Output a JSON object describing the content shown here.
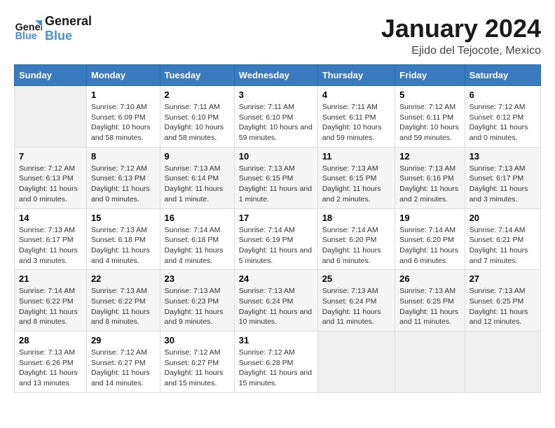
{
  "logo": {
    "line1": "General",
    "line2": "Blue"
  },
  "title": "January 2024",
  "subtitle": "Ejido del Tejocote, Mexico",
  "days_header": [
    "Sunday",
    "Monday",
    "Tuesday",
    "Wednesday",
    "Thursday",
    "Friday",
    "Saturday"
  ],
  "weeks": [
    [
      {
        "day": "",
        "empty": true
      },
      {
        "day": "1",
        "sunrise": "7:10 AM",
        "sunset": "6:09 PM",
        "daylight": "10 hours and 58 minutes."
      },
      {
        "day": "2",
        "sunrise": "7:11 AM",
        "sunset": "6:10 PM",
        "daylight": "10 hours and 58 minutes."
      },
      {
        "day": "3",
        "sunrise": "7:11 AM",
        "sunset": "6:10 PM",
        "daylight": "10 hours and 59 minutes."
      },
      {
        "day": "4",
        "sunrise": "7:11 AM",
        "sunset": "6:11 PM",
        "daylight": "10 hours and 59 minutes."
      },
      {
        "day": "5",
        "sunrise": "7:12 AM",
        "sunset": "6:11 PM",
        "daylight": "10 hours and 59 minutes."
      },
      {
        "day": "6",
        "sunrise": "7:12 AM",
        "sunset": "6:12 PM",
        "daylight": "11 hours and 0 minutes."
      }
    ],
    [
      {
        "day": "7",
        "sunrise": "7:12 AM",
        "sunset": "6:13 PM",
        "daylight": "11 hours and 0 minutes."
      },
      {
        "day": "8",
        "sunrise": "7:12 AM",
        "sunset": "6:13 PM",
        "daylight": "11 hours and 0 minutes."
      },
      {
        "day": "9",
        "sunrise": "7:13 AM",
        "sunset": "6:14 PM",
        "daylight": "11 hours and 1 minute."
      },
      {
        "day": "10",
        "sunrise": "7:13 AM",
        "sunset": "6:15 PM",
        "daylight": "11 hours and 1 minute."
      },
      {
        "day": "11",
        "sunrise": "7:13 AM",
        "sunset": "6:15 PM",
        "daylight": "11 hours and 2 minutes."
      },
      {
        "day": "12",
        "sunrise": "7:13 AM",
        "sunset": "6:16 PM",
        "daylight": "11 hours and 2 minutes."
      },
      {
        "day": "13",
        "sunrise": "7:13 AM",
        "sunset": "6:17 PM",
        "daylight": "11 hours and 3 minutes."
      }
    ],
    [
      {
        "day": "14",
        "sunrise": "7:13 AM",
        "sunset": "6:17 PM",
        "daylight": "11 hours and 3 minutes."
      },
      {
        "day": "15",
        "sunrise": "7:13 AM",
        "sunset": "6:18 PM",
        "daylight": "11 hours and 4 minutes."
      },
      {
        "day": "16",
        "sunrise": "7:14 AM",
        "sunset": "6:18 PM",
        "daylight": "11 hours and 4 minutes."
      },
      {
        "day": "17",
        "sunrise": "7:14 AM",
        "sunset": "6:19 PM",
        "daylight": "11 hours and 5 minutes."
      },
      {
        "day": "18",
        "sunrise": "7:14 AM",
        "sunset": "6:20 PM",
        "daylight": "11 hours and 6 minutes."
      },
      {
        "day": "19",
        "sunrise": "7:14 AM",
        "sunset": "6:20 PM",
        "daylight": "11 hours and 6 minutes."
      },
      {
        "day": "20",
        "sunrise": "7:14 AM",
        "sunset": "6:21 PM",
        "daylight": "11 hours and 7 minutes."
      }
    ],
    [
      {
        "day": "21",
        "sunrise": "7:14 AM",
        "sunset": "6:22 PM",
        "daylight": "11 hours and 8 minutes."
      },
      {
        "day": "22",
        "sunrise": "7:13 AM",
        "sunset": "6:22 PM",
        "daylight": "11 hours and 8 minutes."
      },
      {
        "day": "23",
        "sunrise": "7:13 AM",
        "sunset": "6:23 PM",
        "daylight": "11 hours and 9 minutes."
      },
      {
        "day": "24",
        "sunrise": "7:13 AM",
        "sunset": "6:24 PM",
        "daylight": "11 hours and 10 minutes."
      },
      {
        "day": "25",
        "sunrise": "7:13 AM",
        "sunset": "6:24 PM",
        "daylight": "11 hours and 11 minutes."
      },
      {
        "day": "26",
        "sunrise": "7:13 AM",
        "sunset": "6:25 PM",
        "daylight": "11 hours and 11 minutes."
      },
      {
        "day": "27",
        "sunrise": "7:13 AM",
        "sunset": "6:25 PM",
        "daylight": "11 hours and 12 minutes."
      }
    ],
    [
      {
        "day": "28",
        "sunrise": "7:13 AM",
        "sunset": "6:26 PM",
        "daylight": "11 hours and 13 minutes."
      },
      {
        "day": "29",
        "sunrise": "7:12 AM",
        "sunset": "6:27 PM",
        "daylight": "11 hours and 14 minutes."
      },
      {
        "day": "30",
        "sunrise": "7:12 AM",
        "sunset": "6:27 PM",
        "daylight": "11 hours and 15 minutes."
      },
      {
        "day": "31",
        "sunrise": "7:12 AM",
        "sunset": "6:28 PM",
        "daylight": "11 hours and 15 minutes."
      },
      {
        "day": "",
        "empty": true
      },
      {
        "day": "",
        "empty": true
      },
      {
        "day": "",
        "empty": true
      }
    ]
  ],
  "labels": {
    "sunrise": "Sunrise:",
    "sunset": "Sunset:",
    "daylight": "Daylight hours"
  }
}
